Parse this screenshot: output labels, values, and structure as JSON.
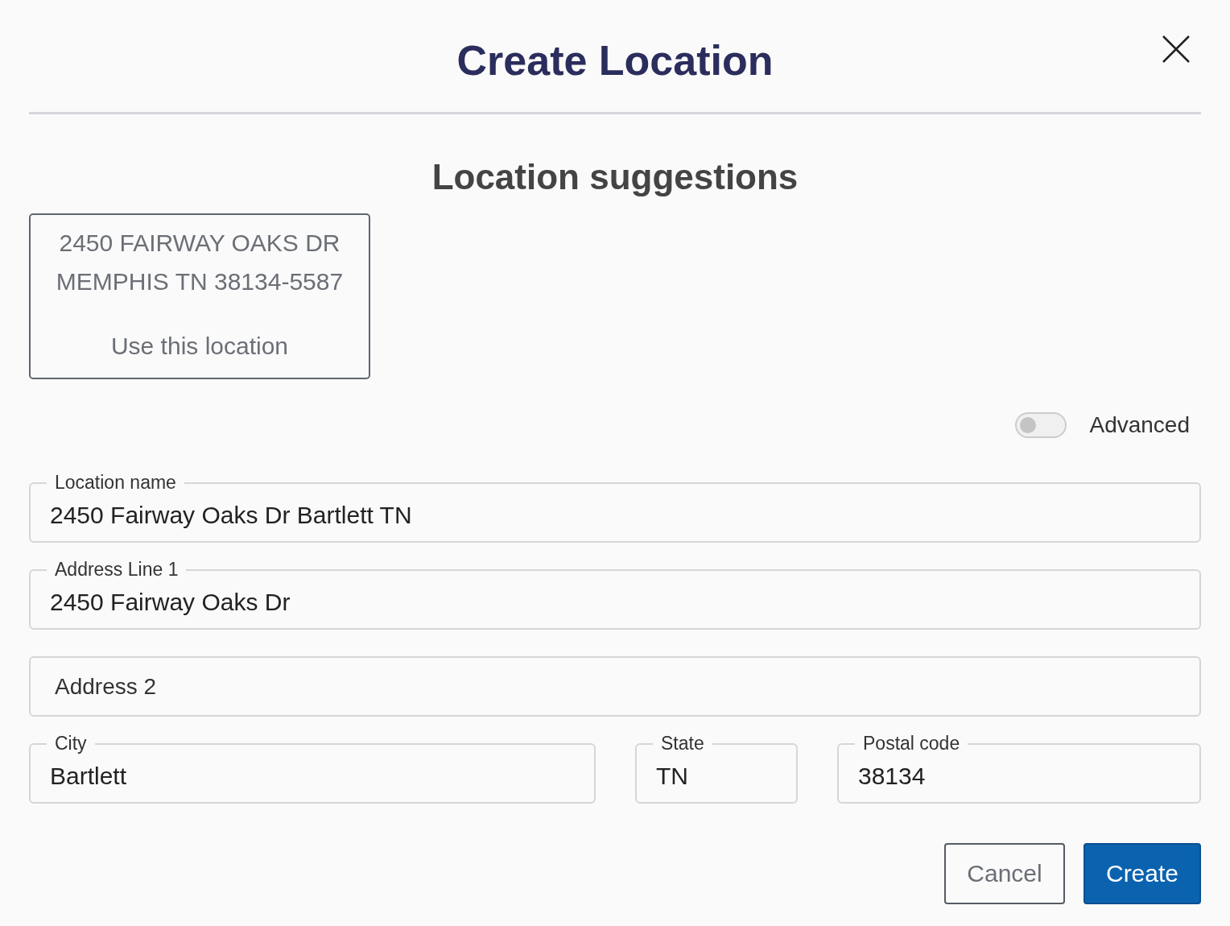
{
  "dialog": {
    "title": "Create Location"
  },
  "suggestions": {
    "heading": "Location suggestions",
    "items": [
      {
        "line_1": "2450 FAIRWAY OAKS DR",
        "line_2": "MEMPHIS TN 38134-5587",
        "action": "Use this location"
      }
    ]
  },
  "advanced": {
    "label": "Advanced",
    "on": false
  },
  "fields": [
    {
      "label": "Location name",
      "value": "2450 Fairway Oaks Dr Bartlett TN"
    },
    {
      "label": "Address Line 1",
      "value": "2450 Fairway Oaks Dr"
    },
    {
      "placeholder": "Address 2"
    },
    {
      "label": "City",
      "value": "Bartlett"
    },
    {
      "label": "State",
      "value": "TN"
    },
    {
      "label": "Postal code",
      "value": "38134"
    }
  ],
  "buttons": [
    {
      "label": "Cancel",
      "kind": "secondary"
    },
    {
      "label": "Create",
      "kind": "primary"
    }
  ]
}
